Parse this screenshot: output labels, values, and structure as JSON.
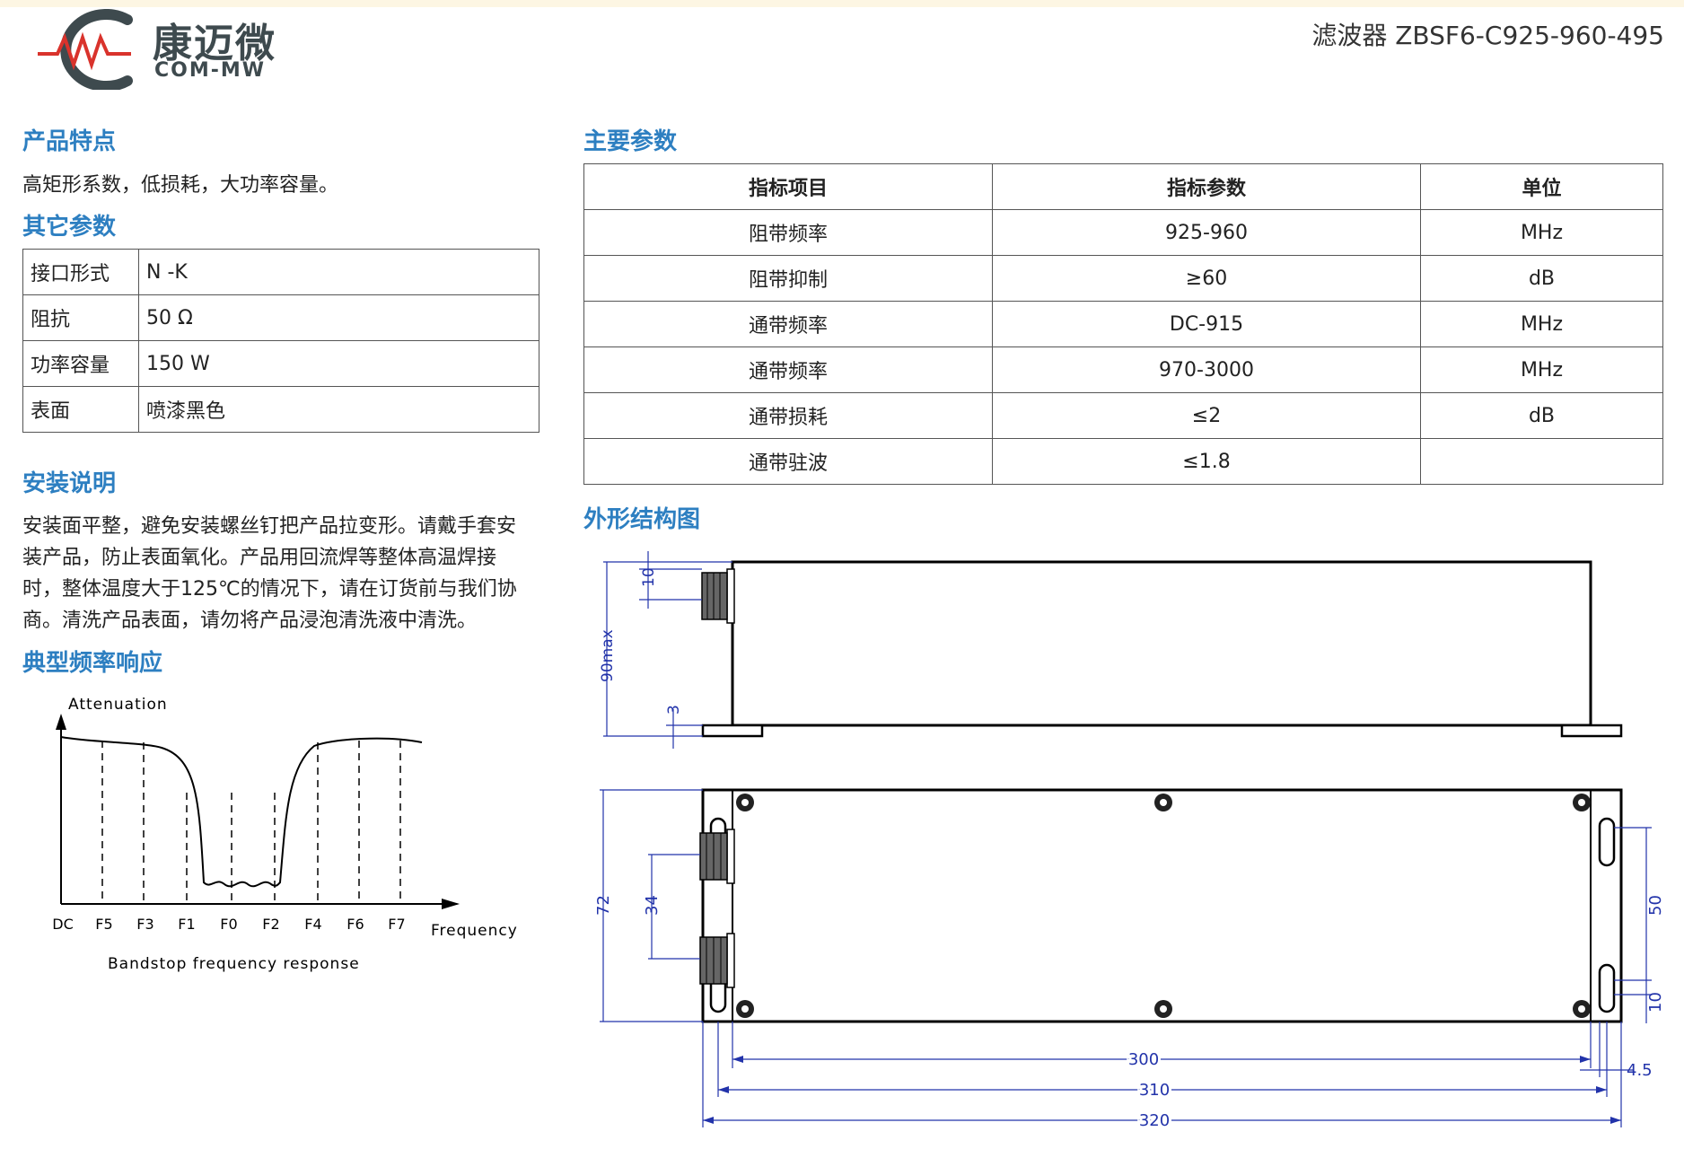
{
  "header": {
    "brand_cn": "康迈微",
    "brand_en": "COM-MW",
    "title": "滤波器 ZBSF6-C925-960-495"
  },
  "features": {
    "heading": "产品特点",
    "text": "高矩形系数，低损耗，大功率容量。"
  },
  "other_params": {
    "heading": "其它参数",
    "rows": [
      {
        "name": "接口形式",
        "value": "N -K"
      },
      {
        "name": "阻抗",
        "value": "50 Ω"
      },
      {
        "name": "功率容量",
        "value": "150 W"
      },
      {
        "name": "表面",
        "value": "喷漆黑色"
      }
    ]
  },
  "install": {
    "heading": "安装说明",
    "lines": [
      "安装面平整，避免安装螺丝钉把产品拉变形。请戴手套安",
      "装产品，防止表面氧化。产品用回流焊等整体高温焊接",
      "时，整体温度大于125℃的情况下，请在订货前与我们协",
      "商。清洗产品表面，请勿将产品浸泡清洗液中清洗。"
    ]
  },
  "response": {
    "heading": "典型频率响应",
    "ylabel": "Attenuation",
    "xlabel": "Frequency",
    "caption": "Bandstop  frequency  response",
    "ticks": [
      "DC",
      "F5",
      "F3",
      "F1",
      "F0",
      "F2",
      "F4",
      "F6",
      "F7"
    ]
  },
  "main_params": {
    "heading": "主要参数",
    "headers": [
      "指标项目",
      "指标参数",
      "单位"
    ],
    "rows": [
      [
        "阻带频率",
        "925-960",
        "MHz"
      ],
      [
        "阻带抑制",
        "≥60",
        "dB"
      ],
      [
        "通带频率",
        "DC-915",
        "MHz"
      ],
      [
        "通带频率",
        "970-3000",
        "MHz"
      ],
      [
        "通带损耗",
        "≤2",
        "dB"
      ],
      [
        "通带驻波",
        "≤1.8",
        ""
      ]
    ]
  },
  "outline": {
    "heading": "外形结构图",
    "dims": {
      "d10_top": "10",
      "d90": "90max",
      "d3": "3",
      "d72": "72",
      "d34": "34",
      "d50": "50",
      "d10_right": "10",
      "d300": "300",
      "d310": "310",
      "d320": "320",
      "d45": "4.5"
    }
  },
  "colors": {
    "heading": "#2d7fc1",
    "brand_gray": "#3e4a4e",
    "brand_red": "#d9332c",
    "dim_blue": "#2233aa"
  }
}
